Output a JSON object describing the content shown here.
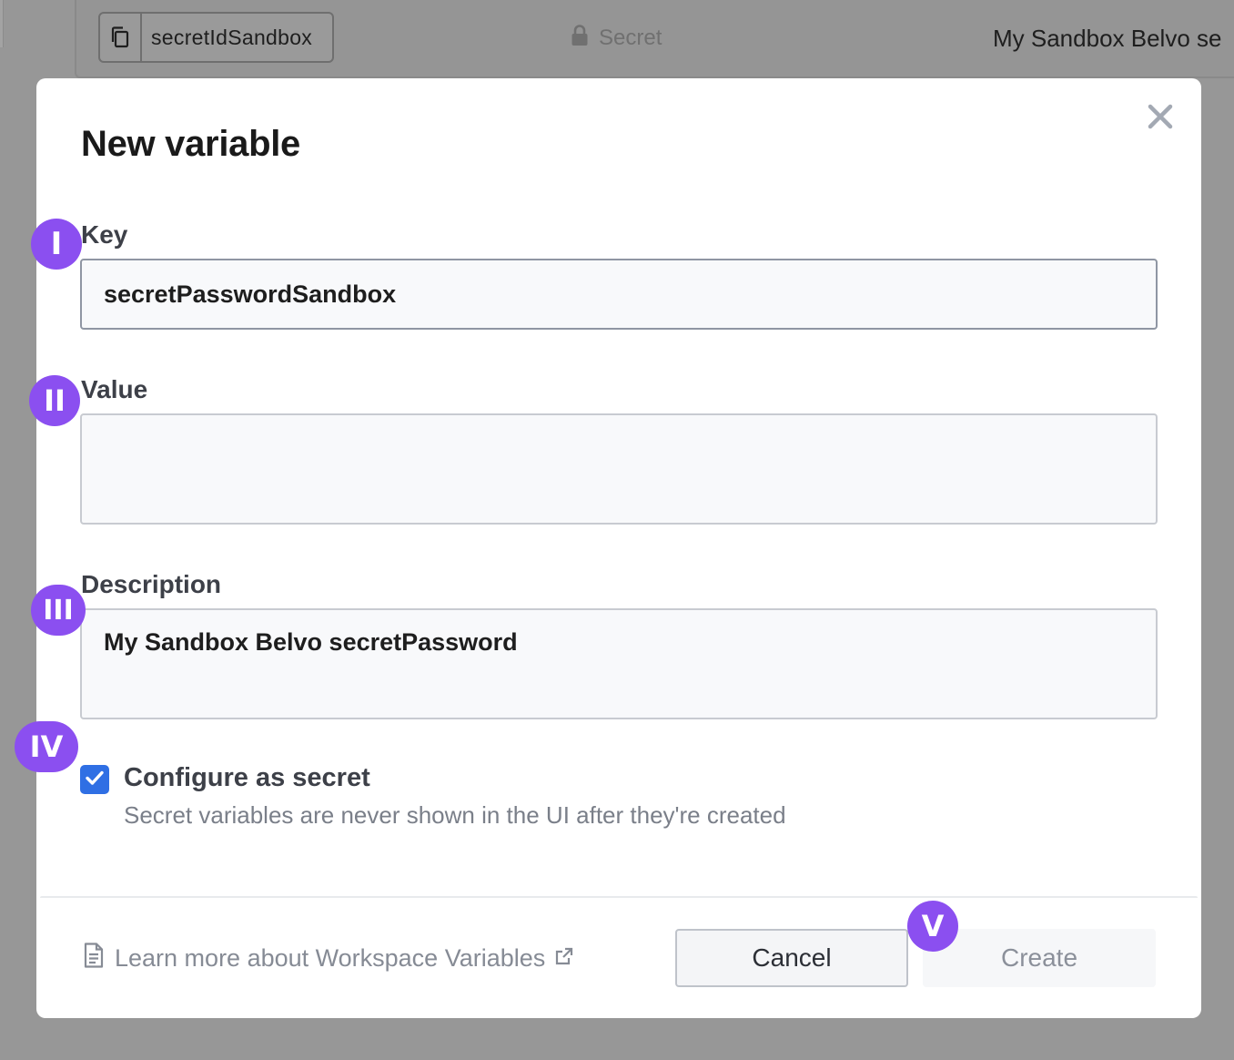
{
  "background": {
    "key_chip": {
      "text": "secretIdSandbox",
      "copy_icon": "copy-icon"
    },
    "secret_badge": {
      "text": "Secret",
      "icon": "lock-icon"
    },
    "description_text": "My Sandbox Belvo se"
  },
  "modal": {
    "title": "New variable",
    "close_icon": "close-icon",
    "key": {
      "label": "Key",
      "value": "secretPasswordSandbox"
    },
    "value": {
      "label": "Value",
      "value": ""
    },
    "description": {
      "label": "Description",
      "value": "My Sandbox Belvo secretPassword"
    },
    "secret_checkbox": {
      "label": "Configure as secret",
      "help": "Secret variables are never shown in the UI after they're created",
      "checked": true
    },
    "footer": {
      "learn_more": "Learn more about Workspace Variables",
      "doc_icon": "document-icon",
      "external_icon": "external-link-icon",
      "cancel_label": "Cancel",
      "create_label": "Create"
    }
  },
  "markers": [
    "I",
    "II",
    "III",
    "IV",
    "V"
  ],
  "colors": {
    "marker": "#8b4ff0",
    "checkbox": "#2f6fe4",
    "overlay": "#979797"
  }
}
